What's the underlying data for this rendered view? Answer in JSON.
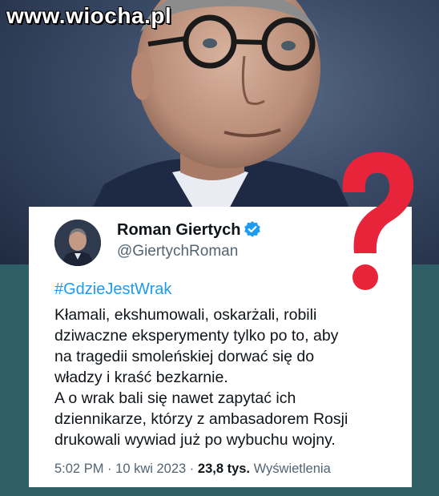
{
  "watermark": "www.wiocha.pl",
  "tweet": {
    "author_name": "Roman Giertych",
    "handle": "@GiertychRoman",
    "hashtag": "#GdzieJestWrak",
    "lines": [
      "Kłamali, ekshumowali, oskarżali, robili",
      "dziwaczne eksperymenty tylko po to, aby",
      "na tragedii smoleńskiej dorwać się do",
      "władzy i kraść bezkarnie.",
      "A o wrak bali się nawet zapytać ich",
      "dziennikarze, którzy z ambasadorem Rosji",
      "drukowali wywiad już po wybuchu wojny."
    ],
    "time": "5:02 PM",
    "date": "10 kwi 2023",
    "views_count": "23,8 tys.",
    "views_label": "Wyświetlenia"
  },
  "colors": {
    "question_mark": "#e8243a",
    "verified": "#1d9bf0",
    "link": "#1d9bf0",
    "teal_band": "#2f5f66"
  },
  "icons": {
    "verified": "verified-badge-icon",
    "question": "question-mark-icon"
  }
}
